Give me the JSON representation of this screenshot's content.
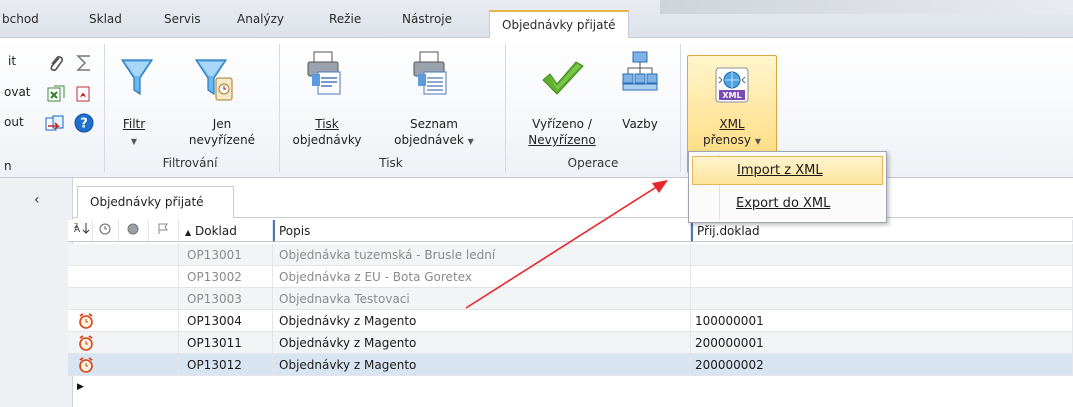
{
  "tabs": [
    {
      "label": "bchod",
      "active": false
    },
    {
      "label": "Sklad",
      "active": false
    },
    {
      "label": "Servis",
      "active": false
    },
    {
      "label": "Analýzy",
      "active": false
    },
    {
      "label": "Režie",
      "active": false
    },
    {
      "label": "Nástroje",
      "active": false
    },
    {
      "label": "Objednávky přijaté",
      "active": true
    }
  ],
  "ribbon": {
    "left_fragments": [
      "it",
      "ovat",
      "out",
      "n"
    ],
    "filtr": {
      "label": "Filtr"
    },
    "jen": {
      "line1": "Jen",
      "line2": "nevyřízené"
    },
    "group_filtrovani": "Filtrování",
    "tisk_obj": {
      "line1": "Tisk",
      "line2": "objednávky"
    },
    "seznam": {
      "line1": "Seznam",
      "line2": "objednávek"
    },
    "group_tisk": "Tisk",
    "vyrizeno": {
      "line1": "Vyřízeno /",
      "line2": "Nevyřízeno"
    },
    "vazby": {
      "label": "Vazby"
    },
    "group_operace": "Operace",
    "xml": {
      "badge": "XML",
      "line1": "XML",
      "line2": "přenosy"
    }
  },
  "dropdown": {
    "items": [
      {
        "label": "Import z XML",
        "highlighted": true
      },
      {
        "label": "Export do XML",
        "highlighted": false
      }
    ]
  },
  "document_tab": "Objednávky přijaté",
  "grid": {
    "columns": [
      "Doklad",
      "Popis",
      "Přij.doklad"
    ],
    "rows": [
      {
        "doklad": "OP13001",
        "popis": "Objednávka tuzemská - Brusle lední",
        "prij": "",
        "alarm": false,
        "style": "grey"
      },
      {
        "doklad": "OP13002",
        "popis": "Objednávka z EU - Bota Goretex",
        "prij": "",
        "alarm": false,
        "style": "white"
      },
      {
        "doklad": "OP13003",
        "popis": "Objednavka Testovaci",
        "prij": "",
        "alarm": false,
        "style": "grey"
      },
      {
        "doklad": "OP13004",
        "popis": "Objednávky z Magento",
        "prij": "100000001",
        "alarm": true,
        "style": "norm"
      },
      {
        "doklad": "OP13011",
        "popis": "Objednávky z Magento",
        "prij": "200000001",
        "alarm": true,
        "style": "alt"
      },
      {
        "doklad": "OP13012",
        "popis": "Objednávky z Magento",
        "prij": "200000002",
        "alarm": true,
        "style": "sel",
        "current": true
      }
    ]
  },
  "colors": {
    "accent": "#e6b84a",
    "selection": "#d9e4f2",
    "arrow": "#e8262a",
    "check": "#5fb030"
  }
}
